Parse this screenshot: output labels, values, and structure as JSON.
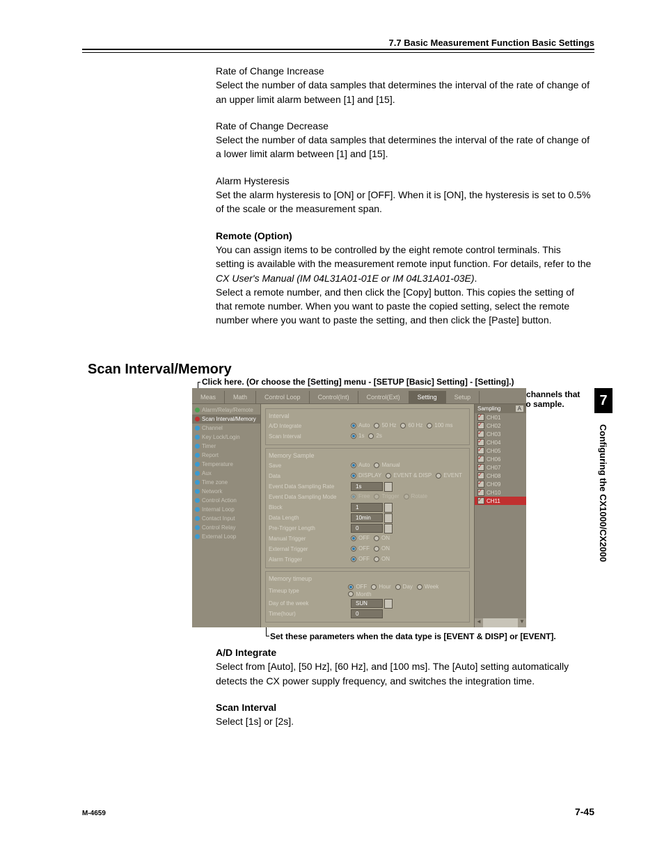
{
  "header": "7.7  Basic Measurement Function Basic Settings",
  "body": {
    "rci_h": "Rate of Change Increase",
    "rci_p": "Select the number of data samples that determines the interval of the rate of change of an upper limit alarm between [1] and [15].",
    "rcd_h": "Rate of Change Decrease",
    "rcd_p": "Select the number of data samples that determines the interval of the rate of change of a lower limit alarm between [1] and [15].",
    "ah_h": "Alarm Hysteresis",
    "ah_p": "Set the alarm hysteresis to [ON] or [OFF].  When it is [ON], the hysteresis is set to 0.5% of the scale or the measurement span.",
    "ro_h": "Remote (Option)",
    "ro_p1": "You can assign items to be controlled by the eight remote control terminals. This setting is available with the measurement remote input function.  For details, refer to the ",
    "ro_p1_i": "CX User's Manual (IM 04L31A01-01E or IM 04L31A01-03E)",
    "ro_p1_end": ".",
    "ro_p2": "Select a remote number, and then click the [Copy] button.  This copies the setting of that remote number.  When you want to paste the copied setting, select the remote number where you want to paste the setting, and then click the [Paste] button."
  },
  "section_h2": "Scan Interval/Memory",
  "callouts": {
    "top": "Click here. (Or choose the [Setting] menu - [SETUP [Basic] Setting] - [Setting].)",
    "right1": "Select the channels that",
    "right2": "you want to sample.",
    "bottom": "Set these parameters when the data type is [EVENT & DISP] or [EVENT]."
  },
  "shot": {
    "tabs": [
      "Meas",
      "Math",
      "Control Loop",
      "Control(Int)",
      "Control(Ext)",
      "Setting",
      "Setup"
    ],
    "active_tab": 5,
    "nav": [
      "Alarm/Relay/Remote",
      "Scan Interval/Memory",
      "Channel",
      "Key Lock/Login",
      "Timer",
      "Report",
      "Temperature",
      "Aux",
      "Time zone",
      "Network",
      "Control Action",
      "Internal Loop",
      "Contact Input",
      "Control Relay",
      "External Loop"
    ],
    "active_nav": 1,
    "groups": {
      "interval": {
        "title": "Interval",
        "ad_label": "A/D Integrate",
        "ad_opts": [
          "Auto",
          "50 Hz",
          "60 Hz",
          "100 ms"
        ],
        "ad_sel": 0,
        "scan_label": "Scan Interval",
        "scan_opts": [
          "1s",
          "2s"
        ],
        "scan_sel": 0
      },
      "memory": {
        "title": "Memory Sample",
        "save_label": "Save",
        "save_opts": [
          "Auto",
          "Manual"
        ],
        "save_sel": 0,
        "data_label": "Data",
        "data_opts": [
          "DISPLAY",
          "EVENT & DISP",
          "EVENT"
        ],
        "data_sel": 0,
        "edsr_label": "Event Data Sampling Rate",
        "edsr_val": "1s",
        "edsm_label": "Event Data Sampling Mode",
        "edsm_opts": [
          "Free",
          "Trigger",
          "Rotate"
        ],
        "edsm_sel": 0,
        "block_label": "Block",
        "block_val": "1",
        "dlen_label": "Data Length",
        "dlen_val": "10min",
        "ptl_label": "Pre-Trigger Length",
        "ptl_val": "0",
        "mt_label": "Manual Trigger",
        "et_label": "External Trigger",
        "at_label": "Alarm Trigger",
        "onoff_opts": [
          "OFF",
          "ON"
        ]
      },
      "timeup": {
        "title": "Memory timeup",
        "tt_label": "Timeup type",
        "tt_opts": [
          "OFF",
          "Hour",
          "Day",
          "Week",
          "Month"
        ],
        "tt_sel": 0,
        "dow_label": "Day of the week",
        "dow_val": "SUN",
        "time_label": "Time(hour)",
        "time_val": "0"
      }
    },
    "side": {
      "title": "Sampling",
      "a_label": "A",
      "channels": [
        "CH01",
        "CH02",
        "CH03",
        "CH04",
        "CH05",
        "CH06",
        "CH07",
        "CH08",
        "CH09",
        "CH10",
        "CH11"
      ],
      "selected_all": true
    }
  },
  "lower": {
    "ad_h": "A/D Integrate",
    "ad_p": "Select from [Auto], [50 Hz], [60 Hz], and [100 ms].  The [Auto] setting automatically detects the CX power supply frequency, and switches the integration time.",
    "si_h": "Scan Interval",
    "si_p": "Select [1s] or [2s]."
  },
  "side_tab": "7",
  "side_label": "Configuring the CX1000/CX2000",
  "footer_left": "M-4659",
  "footer_right": "7-45"
}
